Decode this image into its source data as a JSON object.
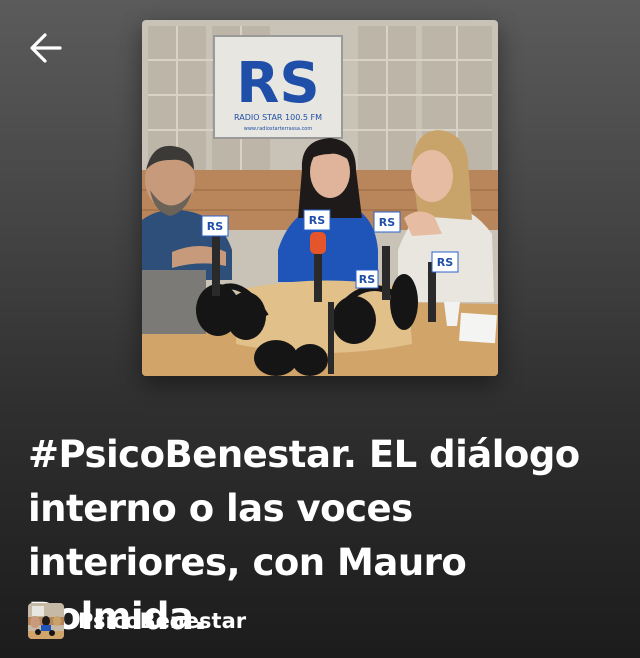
{
  "header": {
    "back_icon": "arrow-left-icon"
  },
  "episode": {
    "title": "#PsicoBenestar. EL diálogo interno o las voces interiores, con Mauro Bolmida.",
    "cover_logo_text": "RS",
    "cover_logo_subtitle": "RADIO STAR 100.5 FM",
    "cover_logo_url": "www.radiostarterrassa.com",
    "mic_flag_text": "RS"
  },
  "show": {
    "name": "PsicoBenestar"
  },
  "colors": {
    "background_top": "#5b5b5b",
    "background_bottom": "#1c1c1c",
    "text": "#ffffff",
    "logo_blue": "#1f4fa8"
  }
}
